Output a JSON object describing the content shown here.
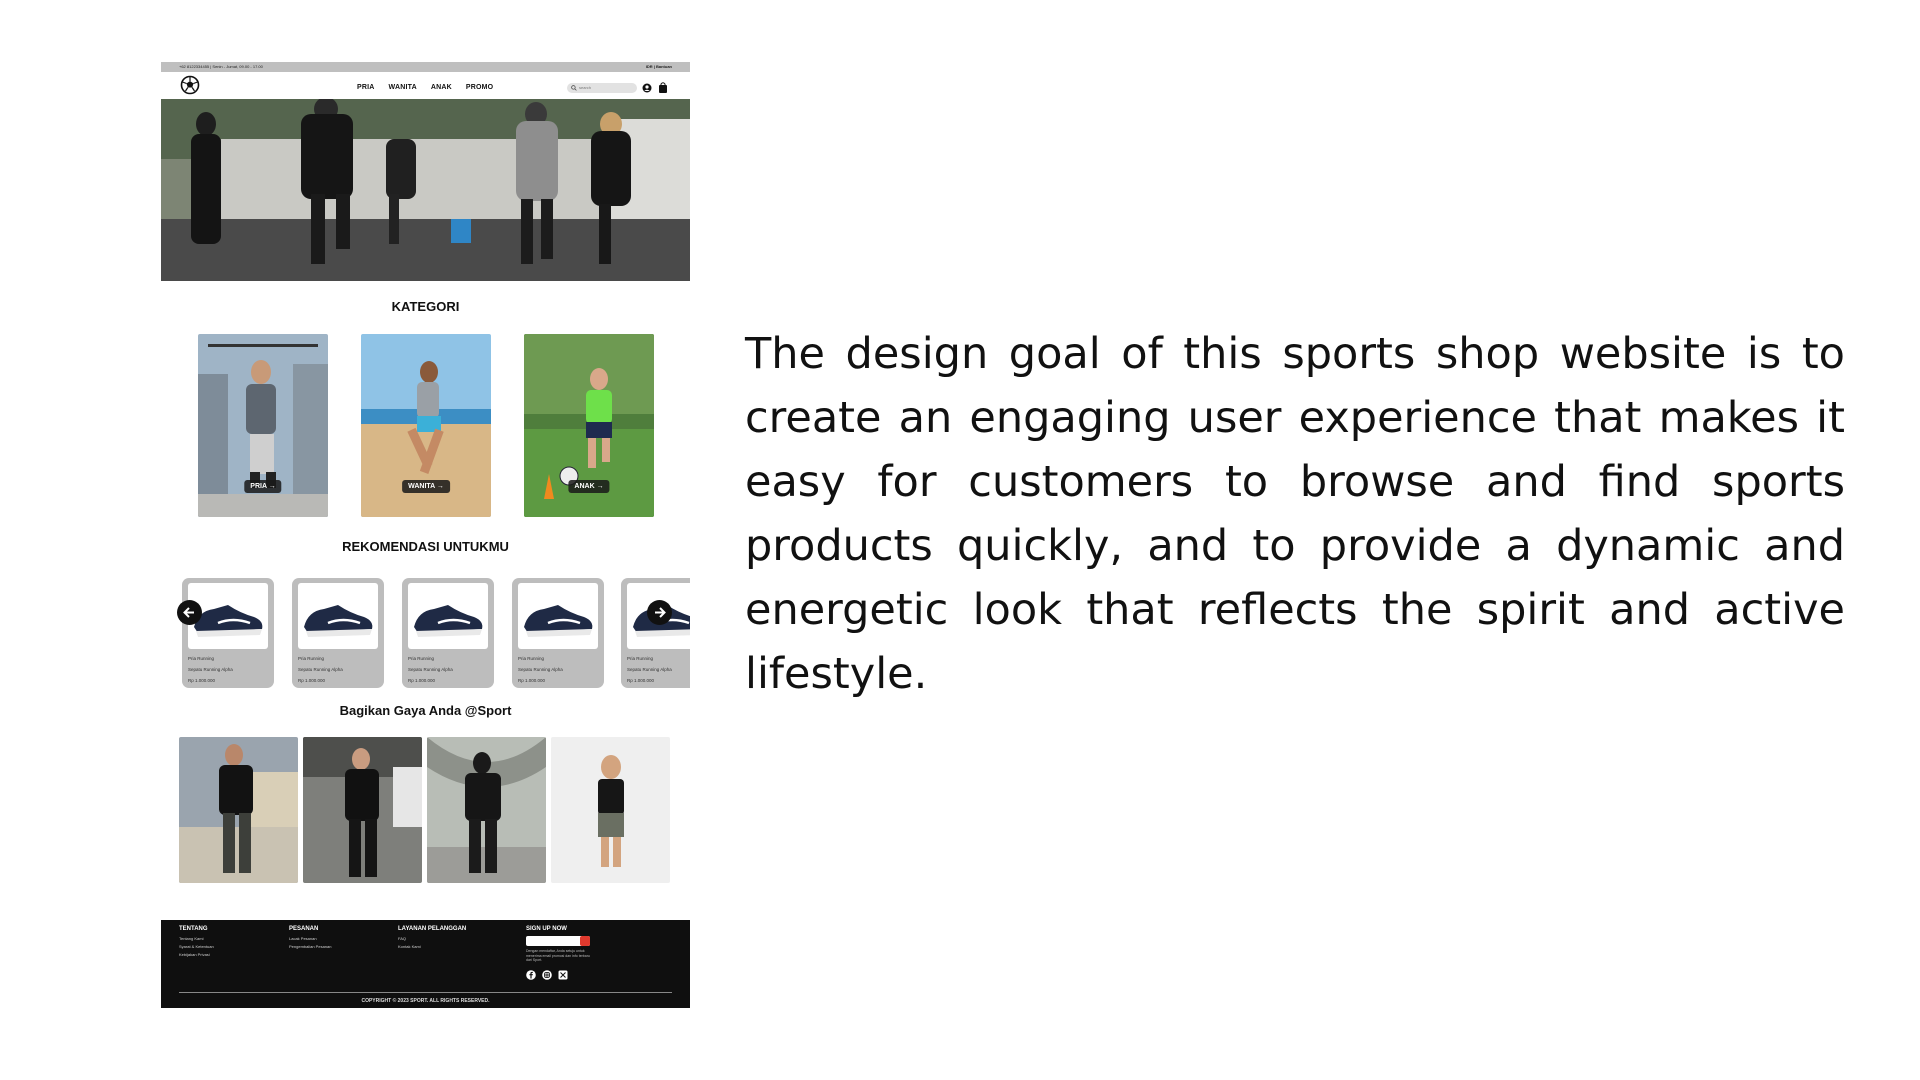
{
  "mockup": {
    "topbar": {
      "left_text": "+62 8122334455 | Senin - Jumat, 09.00 - 17.00",
      "right_text": "IDR | Bantuan"
    },
    "nav": {
      "items": [
        "PRIA",
        "WANITA",
        "ANAK",
        "PROMO"
      ],
      "search_placeholder": "search"
    },
    "kategori": {
      "title": "KATEGORI",
      "cards": [
        {
          "label": "PRIA →"
        },
        {
          "label": "WANITA →"
        },
        {
          "label": "ANAK →"
        }
      ]
    },
    "rekomendasi": {
      "title": "REKOMENDASI UNTUKMU",
      "products": [
        {
          "category": "Pria Running",
          "name": "Sepatu Running Alpha",
          "price": "Rp 1.000.000"
        },
        {
          "category": "Pria Running",
          "name": "Sepatu Running Alpha",
          "price": "Rp 1.000.000"
        },
        {
          "category": "Pria Running",
          "name": "Sepatu Running Alpha",
          "price": "Rp 1.000.000"
        },
        {
          "category": "Pria Running",
          "name": "Sepatu Running Alpha",
          "price": "Rp 1.000.000"
        },
        {
          "category": "Pria Running",
          "name": "Sepatu Running Alpha",
          "price": "Rp 1.000.000"
        }
      ]
    },
    "gaya": {
      "title": "Bagikan Gaya Anda @Sport"
    },
    "footer": {
      "col1": {
        "head": "TENTANG",
        "links": [
          "Tentang Kami",
          "Syarat & Ketentuan",
          "Kebijakan Privasi"
        ]
      },
      "col2": {
        "head": "PESANAN",
        "links": [
          "Lacak Pesanan",
          "Pengembalian Pesanan"
        ]
      },
      "col3": {
        "head": "LAYANAN PELANGGAN",
        "links": [
          "FAQ",
          "Kontak Kami"
        ]
      },
      "col4": {
        "head": "SIGN UP NOW",
        "note": "Dengan mendaftar, Anda setuju untuk menerima email promosi dan info terbaru dari Sport."
      },
      "copyright": "COPYRIGHT © 2023 SPORT. ALL RIGHTS RESERVED."
    }
  },
  "description": "The design goal of this sports shop website is to create an engaging user experience that makes it easy for customers to browse and find sports products quickly, and to provide a dynamic and energetic look that reflects the spirit and active lifestyle."
}
